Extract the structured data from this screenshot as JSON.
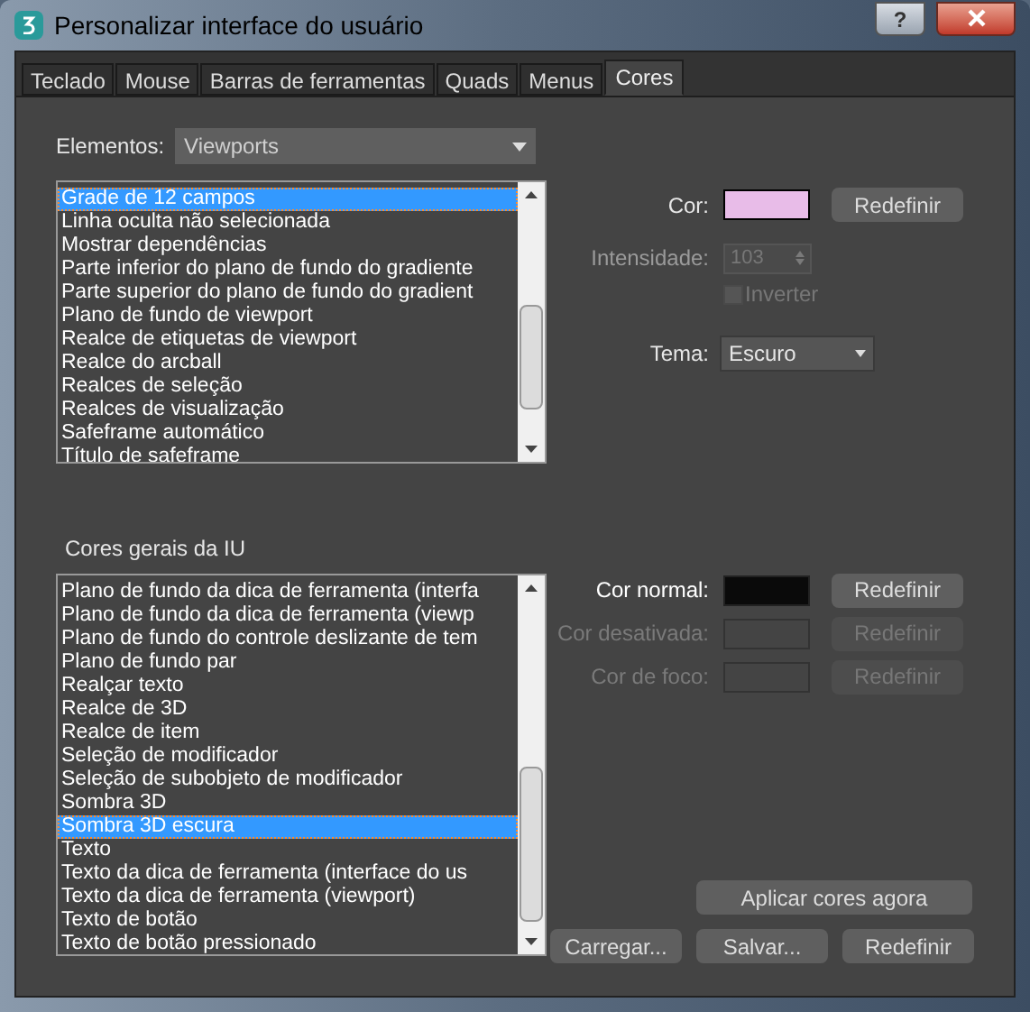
{
  "window": {
    "title": "Personalizar interface do usuário",
    "help": "?"
  },
  "tabs": [
    {
      "label": "Teclado",
      "selected": false
    },
    {
      "label": "Mouse",
      "selected": false
    },
    {
      "label": "Barras de ferramentas",
      "selected": false
    },
    {
      "label": "Quads",
      "selected": false
    },
    {
      "label": "Menus",
      "selected": false
    },
    {
      "label": "Cores",
      "selected": true
    }
  ],
  "elements": {
    "label": "Elementos:",
    "value": "Viewports"
  },
  "element_list": [
    {
      "label": "Grade de 12 campos",
      "selected": true
    },
    {
      "label": "Linha oculta não selecionada",
      "selected": false
    },
    {
      "label": "Mostrar dependências",
      "selected": false
    },
    {
      "label": "Parte inferior do plano de fundo do gradiente",
      "selected": false
    },
    {
      "label": "Parte superior do plano de fundo do gradient",
      "selected": false
    },
    {
      "label": "Plano de fundo de viewport",
      "selected": false
    },
    {
      "label": "Realce de etiquetas de viewport",
      "selected": false
    },
    {
      "label": "Realce do arcball",
      "selected": false
    },
    {
      "label": "Realces de seleção",
      "selected": false
    },
    {
      "label": "Realces de visualização",
      "selected": false
    },
    {
      "label": "Safeframe automático",
      "selected": false
    },
    {
      "label": "Título de safeframe",
      "selected": false
    }
  ],
  "color": {
    "label": "Cor:",
    "color": "#e8bce8",
    "reset": "Redefinir"
  },
  "intensity": {
    "label": "Intensidade:",
    "value": "103",
    "disabled": true
  },
  "invert": {
    "label": "Inverter",
    "checked": false,
    "disabled": true
  },
  "theme": {
    "label": "Tema:",
    "value": "Escuro"
  },
  "general": {
    "title": "Cores gerais da IU",
    "items": [
      {
        "label": "Plano de fundo da dica de ferramenta (interfa",
        "selected": false
      },
      {
        "label": "Plano de fundo da dica de ferramenta (viewp",
        "selected": false
      },
      {
        "label": "Plano de fundo do controle deslizante de tem",
        "selected": false
      },
      {
        "label": "Plano de fundo par",
        "selected": false
      },
      {
        "label": "Realçar texto",
        "selected": false
      },
      {
        "label": "Realce de 3D",
        "selected": false
      },
      {
        "label": "Realce de item",
        "selected": false
      },
      {
        "label": "Seleção de modificador",
        "selected": false
      },
      {
        "label": "Seleção de subobjeto de modificador",
        "selected": false
      },
      {
        "label": "Sombra 3D",
        "selected": false
      },
      {
        "label": "Sombra 3D escura",
        "selected": true
      },
      {
        "label": "Texto",
        "selected": false
      },
      {
        "label": "Texto da dica de ferramenta (interface do us",
        "selected": false
      },
      {
        "label": "Texto da dica de ferramenta (viewport)",
        "selected": false
      },
      {
        "label": "Texto de botão",
        "selected": false
      },
      {
        "label": "Texto de botão pressionado",
        "selected": false
      }
    ]
  },
  "color_rows": [
    {
      "label": "Cor normal:",
      "disabled": false,
      "color": "#0a0a0a",
      "reset": "Redefinir"
    },
    {
      "label": "Cor desativada:",
      "disabled": true,
      "reset": "Redefinir"
    },
    {
      "label": "Cor de foco:",
      "disabled": true,
      "reset": "Redefinir"
    }
  ],
  "apply_button": "Aplicar cores agora",
  "footer_buttons": [
    "Carregar...",
    "Salvar...",
    "Redefinir"
  ]
}
